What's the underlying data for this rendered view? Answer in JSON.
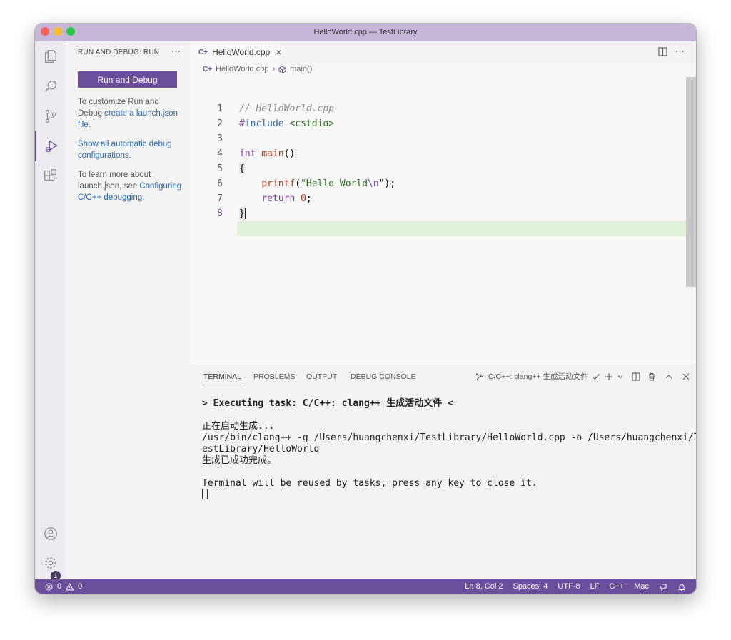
{
  "window": {
    "title": "HelloWorld.cpp — TestLibrary",
    "traffic_lights": [
      "#ff5f57",
      "#febc2e",
      "#28c840"
    ]
  },
  "activity_bar": {
    "items": [
      "explorer",
      "search",
      "source-control",
      "run-and-debug",
      "extensions"
    ],
    "active": "run-and-debug",
    "bottom": [
      "accounts",
      "manage"
    ],
    "manage_badge": "1"
  },
  "sidebar": {
    "title": "RUN AND DEBUG: RUN",
    "more": "···",
    "run_button": "Run and Debug",
    "p1_text": "To customize Run and Debug ",
    "p1_link": "create a launch.json file.",
    "p2_link": "Show all automatic debug configurations.",
    "p3_text": "To learn more about launch.json, see ",
    "p3_link": "Configuring C/C++ debugging."
  },
  "editor": {
    "tab_label": "HelloWorld.cpp",
    "tab_close": "×",
    "tab_more": "···",
    "breadcrumb_file": "HelloWorld.cpp",
    "breadcrumb_sep": "›",
    "breadcrumb_symbol": "main()",
    "line_numbers": [
      "1",
      "2",
      "3",
      "4",
      "5",
      "6",
      "7",
      "8"
    ],
    "lines": {
      "l1": "// HelloWorld.cpp",
      "l2_pre": "#",
      "l2_kw": "include",
      "l2_sp": " ",
      "l2_str": "<cstdio>",
      "l4_kw": "int",
      "l4_fn": "main",
      "l4_rest": "()",
      "l5": "{",
      "l6_ind": "    ",
      "l6_fn": "printf",
      "l6_open": "(",
      "l6_str": "\"Hello World",
      "l6_esc": "\\n",
      "l6_end": "\");",
      "l7_ind": "    ",
      "l7_kw": "return",
      "l7_sp": " ",
      "l7_num": "0",
      "l7_end": ";",
      "l8": "}"
    },
    "current_line": "8"
  },
  "terminal": {
    "tabs": [
      "TERMINAL",
      "PROBLEMS",
      "OUTPUT",
      "DEBUG CONSOLE"
    ],
    "active_tab": "TERMINAL",
    "task_name": "C/C++: clang++ 生成活动文件",
    "lines": [
      "> Executing task: C/C++: clang++ 生成活动文件 <",
      "",
      "正在启动生成...",
      "/usr/bin/clang++ -g /Users/huangchenxi/TestLibrary/HelloWorld.cpp -o /Users/huangchenxi/T",
      "estLibrary/HelloWorld",
      "生成已成功完成。",
      "",
      "Terminal will be reused by tasks, press any key to close it."
    ]
  },
  "status_bar": {
    "errors": "0",
    "warnings": "0",
    "position": "Ln 8, Col 2",
    "spaces": "Spaces: 4",
    "encoding": "UTF-8",
    "eol": "LF",
    "language": "C++",
    "platform": "Mac",
    "color": "#6b4f9b"
  }
}
